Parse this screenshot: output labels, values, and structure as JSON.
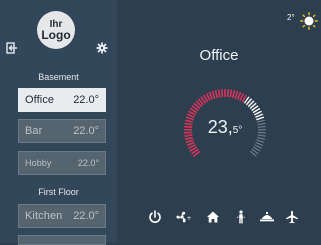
{
  "sidebar": {
    "logo_line1": "Ihr",
    "logo_line2": "Logo",
    "groups": [
      {
        "label": "Basement",
        "rooms": [
          {
            "name": "Office",
            "temp": "22.0°",
            "active": true
          },
          {
            "name": "Bar",
            "temp": "22.0°",
            "active": false
          },
          {
            "name": "Hobby",
            "temp": "22.0°",
            "active": false
          }
        ]
      },
      {
        "label": "First Floor",
        "rooms": [
          {
            "name": "Kitchen",
            "temp": "22.0°",
            "active": false
          }
        ]
      }
    ]
  },
  "weather": {
    "temp": "2°",
    "icon": "sun-icon"
  },
  "main": {
    "title": "Office",
    "dial_int": "23,",
    "dial_frac": "5°",
    "dial_level": 0.63
  },
  "bottom_bar": [
    {
      "icon": "power-icon"
    },
    {
      "icon": "fan-icon"
    },
    {
      "icon": "home-icon"
    },
    {
      "icon": "person-icon"
    },
    {
      "icon": "tray-icon"
    },
    {
      "icon": "airplane-icon"
    }
  ],
  "colors": {
    "background": "#2d3e4e",
    "sidebar": "#33475a",
    "accent_red": "#d8335a",
    "active_room": "#e8ecef"
  }
}
